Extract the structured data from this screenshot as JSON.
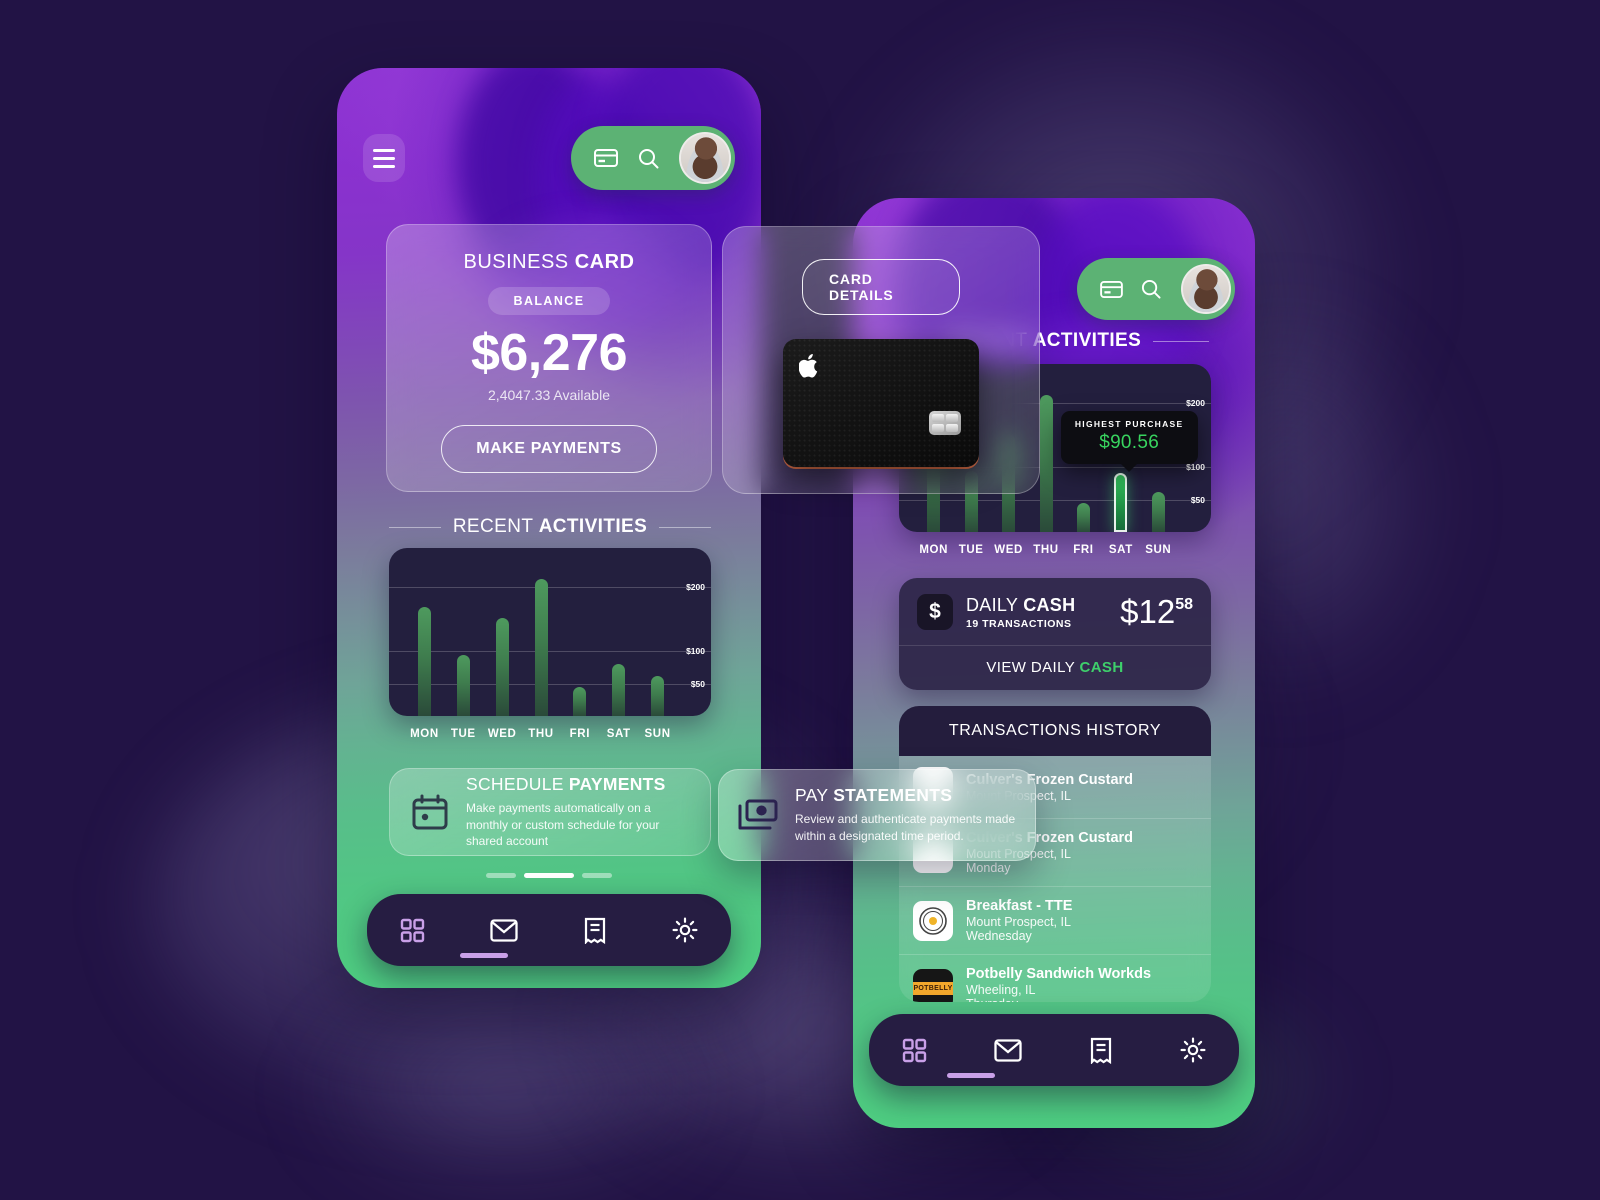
{
  "theme": {
    "bg": "#221345",
    "accent_green": "#5cb274",
    "accent_purple": "#8f35d4",
    "chart_bg": "#231f3e",
    "highlight_green": "#38d45f",
    "nav_active": "#c9a0e8"
  },
  "phone_left": {
    "header": {
      "menu_icon": "hamburger-icon",
      "card_icon": "credit-card-icon",
      "search_icon": "search-icon",
      "avatar": "user-avatar"
    },
    "business_card": {
      "title_light": "BUSINESS",
      "title_bold": "CARD",
      "balance_chip": "BALANCE",
      "amount": "$6,276",
      "available": "2,4047.33 Available",
      "cta": "MAKE PAYMENTS"
    },
    "section": {
      "light": "RECENT",
      "bold": "ACTIVITIES"
    },
    "schedule_card": {
      "icon": "calendar-icon",
      "title_light": "SCHEDULE",
      "title_bold": "PAYMENTS",
      "desc": "Make payments automatically on a monthly or custom schedule for your shared account"
    },
    "indicators": {
      "count": 3,
      "active_index": 1
    },
    "nav": [
      {
        "name": "grid-icon",
        "label": "Dashboard",
        "active": true
      },
      {
        "name": "mail-icon",
        "label": "Messages",
        "active": false
      },
      {
        "name": "receipt-icon",
        "label": "Statements",
        "active": false
      },
      {
        "name": "gear-icon",
        "label": "Settings",
        "active": false
      }
    ]
  },
  "card_overlay": {
    "button": "CARD DETAILS",
    "card_brand_icon": "apple-logo-icon",
    "chip_icon": "emv-chip-icon"
  },
  "pay_statements": {
    "icon": "money-bill-icon",
    "title_light": "PAY",
    "title_bold": "STATEMENTS",
    "desc": "Review and authenticate payments made within a designated time period."
  },
  "phone_right": {
    "header": {
      "card_icon": "credit-card-icon",
      "search_icon": "search-icon",
      "avatar": "user-avatar"
    },
    "section": {
      "light": "RECENT",
      "bold": "ACTIVITIES"
    },
    "daily_cash": {
      "icon": "dollar-sign-icon",
      "title_light": "DAILY",
      "title_bold": "CASH",
      "transactions": "19 TRANSACTIONS",
      "amount_main": "$12",
      "amount_cents": "58",
      "link_light": "VIEW DAILY",
      "link_bold": "CASH"
    },
    "transactions": {
      "header": "TRANSACTIONS HISTORY",
      "rows": [
        {
          "icon": "custard-shop-icon",
          "name": "Culver's Frozen Custard",
          "location": "Mount Prospect, IL",
          "day": ""
        },
        {
          "icon": "custard-shop-icon",
          "name": "Culver's Frozen Custard",
          "location": "Mount Prospect, IL",
          "day": "Monday"
        },
        {
          "icon": "breakfast-tte-icon",
          "name": "Breakfast - TTE",
          "location": "Mount Prospect, IL",
          "day": "Wednesday"
        },
        {
          "icon": "potbelly-icon",
          "name": "Potbelly Sandwich Workds",
          "location": "Wheeling, IL",
          "day": "Thursday"
        }
      ]
    },
    "nav": [
      {
        "name": "grid-icon",
        "label": "Dashboard",
        "active": true
      },
      {
        "name": "mail-icon",
        "label": "Messages",
        "active": false
      },
      {
        "name": "receipt-icon",
        "label": "Statements",
        "active": false
      },
      {
        "name": "gear-icon",
        "label": "Settings",
        "active": false
      }
    ]
  },
  "chart_data": [
    {
      "id": "left-chart",
      "type": "bar",
      "title": "RECENT ACTIVITIES",
      "categories": [
        "MON",
        "TUE",
        "WED",
        "THU",
        "FRI",
        "SAT",
        "SUN"
      ],
      "values": [
        168,
        95,
        152,
        212,
        45,
        80,
        62
      ],
      "tick_labels": [
        "$200",
        "$100",
        "$50"
      ],
      "ticks": [
        200,
        100,
        50
      ],
      "ylim": [
        0,
        260
      ],
      "xlabel": "",
      "ylabel": "",
      "grid": true,
      "legend": "none"
    },
    {
      "id": "right-chart",
      "type": "bar",
      "title": "RECENT ACTIVITIES",
      "categories": [
        "MON",
        "TUE",
        "WED",
        "THU",
        "FRI",
        "SAT",
        "SUN"
      ],
      "values": [
        168,
        95,
        152,
        212,
        45,
        90.56,
        62
      ],
      "tick_labels": [
        "$200",
        "$100",
        "$50"
      ],
      "ticks": [
        200,
        100,
        50
      ],
      "ylim": [
        0,
        260
      ],
      "highlight_index": 5,
      "annotation": {
        "label": "HIGHEST PURCHASE",
        "value": "$90.56",
        "at": "SAT"
      },
      "xlabel": "",
      "ylabel": "",
      "grid": true,
      "legend": "none"
    }
  ]
}
